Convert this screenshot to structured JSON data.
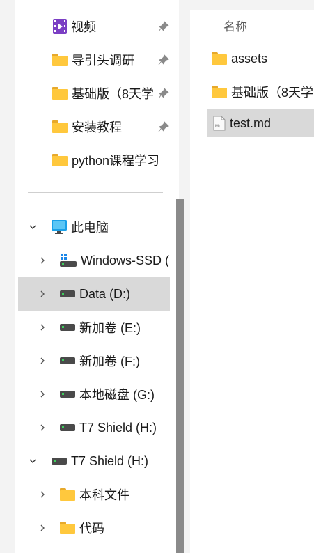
{
  "nav": {
    "pinned": [
      {
        "label": "视频",
        "icon": "videos-icon",
        "pinned": true
      },
      {
        "label": "导引头调研",
        "icon": "folder-icon",
        "pinned": true
      },
      {
        "label": "基础版（8天学",
        "icon": "folder-icon",
        "pinned": true
      },
      {
        "label": "安装教程",
        "icon": "folder-icon",
        "pinned": true
      },
      {
        "label": "python课程学习",
        "icon": "folder-icon",
        "pinned": false
      }
    ],
    "this_pc": {
      "label": "此电脑",
      "drives": [
        {
          "label": "Windows-SSD (",
          "icon": "windows-drive-icon"
        },
        {
          "label": "Data (D:)",
          "icon": "drive-icon"
        },
        {
          "label": "新加卷 (E:)",
          "icon": "drive-icon"
        },
        {
          "label": "新加卷 (F:)",
          "icon": "drive-icon"
        },
        {
          "label": "本地磁盘 (G:)",
          "icon": "drive-icon"
        },
        {
          "label": "T7 Shield (H:)",
          "icon": "drive-icon"
        }
      ]
    },
    "external": {
      "label": "T7 Shield (H:)",
      "children": [
        {
          "label": "本科文件",
          "icon": "folder-icon"
        },
        {
          "label": "代码",
          "icon": "folder-icon"
        }
      ]
    }
  },
  "content": {
    "header": "名称",
    "items": [
      {
        "name": "assets",
        "icon": "folder-icon"
      },
      {
        "name": "基础版（8天学",
        "icon": "folder-icon"
      },
      {
        "name": "test.md",
        "icon": "markdown-file-icon"
      }
    ]
  },
  "colors": {
    "folder": "#ffc83d",
    "selection": "#d9d9d9",
    "monitor": "#1aa0e8"
  }
}
